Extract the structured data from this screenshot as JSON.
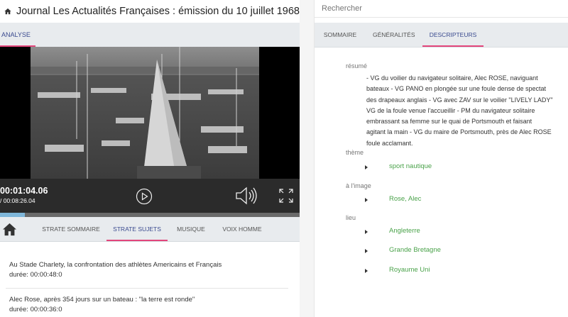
{
  "header": {
    "title": "Journal Les Actualités Françaises : émission du 10 juillet 1968",
    "icon": "home-icon"
  },
  "left_tabs": {
    "analyse": "ANALYSE"
  },
  "player": {
    "current_time": "00:01:04.06",
    "total_time": "/ 00:08:26.04",
    "progress": 0.082
  },
  "strates": {
    "sommaire": "STRATE SOMMAIRE",
    "sujets": "STRATE SUJETS",
    "musique": "MUSIQUE",
    "voix": "VOIX HOMME"
  },
  "subjects": [
    {
      "title": "Au Stade Charlety, la confrontation des athlètes Americains et Français",
      "duration": "durée: 00:00:48:0"
    },
    {
      "title": "Alec Rose, après 354 jours sur un bateau : \"la terre est ronde\"",
      "duration": "durée: 00:00:36:0"
    }
  ],
  "search": {
    "placeholder": "Rechercher"
  },
  "right_tabs": {
    "sommaire": "SOMMAIRE",
    "generalites": "GÉNÉRALITÉS",
    "descripteurs": "DESCRIPTEURS"
  },
  "descripteurs": {
    "resume_label": "résumé",
    "resume_lines": [
      "- VG du voilier du navigateur solitaire, Alec ROSE, naviguant",
      "bateaux - VG PANO en plongée sur une foule dense de spectat",
      "des drapeaux anglais - VG avec ZAV sur le voilier \"LIVELY LADY\"",
      "VG de la foule venue l'accueillir - PM du navigateur solitaire",
      "embrassant sa femme sur le quai de Portsmouth et faisant",
      "agitant la main - VG du maire de Portsmouth, près de Alec ROSE",
      "foule acclamant."
    ],
    "theme_label": "thème",
    "theme_items": [
      "sport nautique"
    ],
    "image_label": "à l'image",
    "image_items": [
      "Rose, Alec"
    ],
    "lieu_label": "lieu",
    "lieu_items": [
      "Angleterre",
      "Grande Bretagne",
      "Royaume Uni"
    ]
  },
  "colors": {
    "accent": "#e2457b",
    "tab_active": "#3a4a8f",
    "term": "#4aa24a",
    "tab_bg": "#e8ebee"
  }
}
